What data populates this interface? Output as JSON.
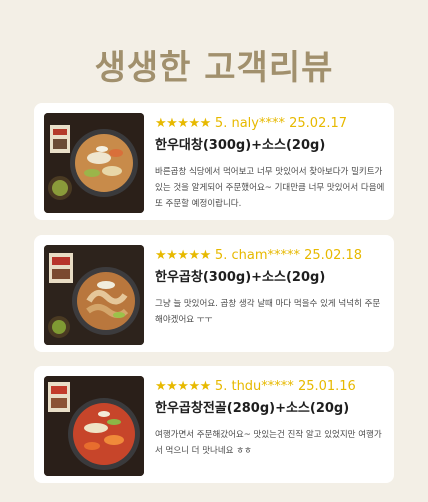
{
  "page_title": "생생한 고객리뷰",
  "reviews": [
    {
      "stars": "★★★★★",
      "rating": "5.",
      "user": "naly****",
      "date": "25.02.17",
      "product": "한우대창(300g)+소스(20g)",
      "text": "바른곱창 식당에서 먹어보고 너무 맛있어서 찾아보다가 밀키트가 있는 것을 알게되어 주문했어요~ 기대만큼 너무 맛있어서 다음에 또 주문할 예정이랍니다.",
      "image": "daechang-dish-photo"
    },
    {
      "stars": "★★★★★",
      "rating": "5.",
      "user": "cham*****",
      "date": "25.02.18",
      "product": "한우곱창(300g)+소스(20g)",
      "text": "그냥 늘 맛있어요. 곱창 생각 날때 마다 먹을수 있게 넉넉히 주문해야겠어요 ㅜㅜ",
      "image": "gopchang-dish-photo"
    },
    {
      "stars": "★★★★★",
      "rating": "5.",
      "user": "thdu*****",
      "date": "25.01.16",
      "product": "한우곱창전골(280g)+소스(20g)",
      "text": "여행가면서 주문해갔어요~ 맛있는건 진작 알고 있었지만 여행가서 먹으니 더 맛나네요 ㅎㅎ",
      "image": "gopchang-jeongol-photo"
    }
  ]
}
